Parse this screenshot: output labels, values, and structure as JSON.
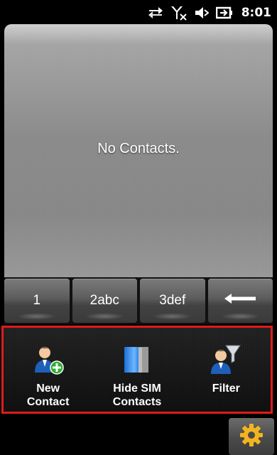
{
  "status_bar": {
    "icons": [
      "data-sync-icon",
      "no-signal-icon",
      "volume-muted-icon",
      "battery-charging-icon"
    ],
    "time": "8:01"
  },
  "content": {
    "empty_message": "No Contacts."
  },
  "keypad": {
    "keys": [
      "1",
      "2abc",
      "3def"
    ],
    "backspace_icon": "backspace-arrow-icon"
  },
  "action_bar": {
    "highlight_color": "#e01b1b",
    "actions": [
      {
        "label": "New\nContact",
        "icon": "new-contact-icon"
      },
      {
        "label": "Hide SIM\nContacts",
        "icon": "sim-card-icon"
      },
      {
        "label": "Filter",
        "icon": "filter-icon"
      }
    ]
  },
  "bottom_bar": {
    "settings_icon": "gear-icon",
    "accent": "#f3b51f"
  }
}
